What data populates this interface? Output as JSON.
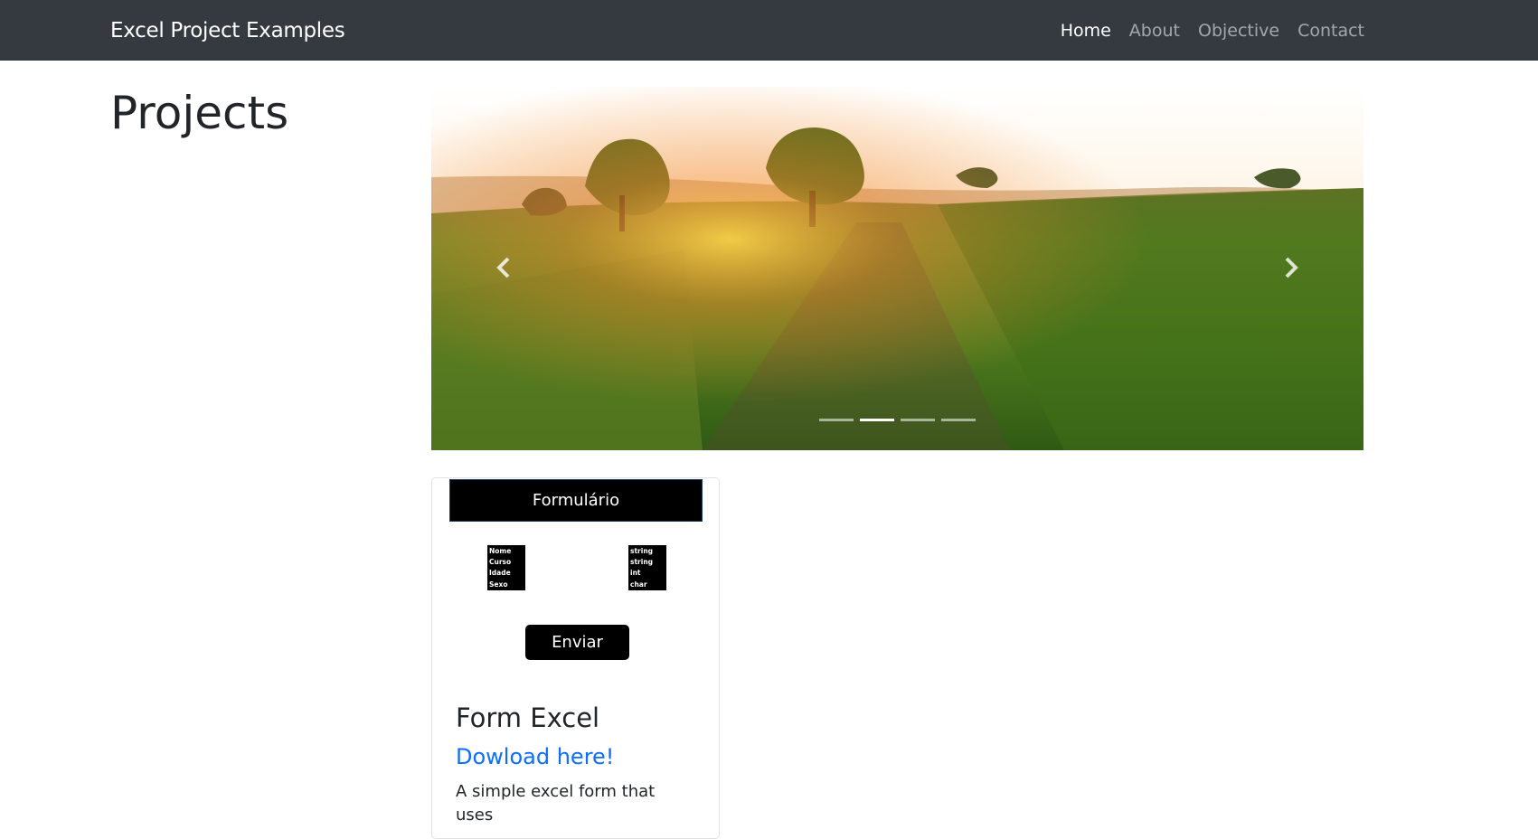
{
  "navbar": {
    "brand": "Excel Project Examples",
    "links": [
      {
        "label": "Home",
        "active": true
      },
      {
        "label": "About",
        "active": false
      },
      {
        "label": "Objective",
        "active": false
      },
      {
        "label": "Contact",
        "active": false
      }
    ]
  },
  "page": {
    "title": "Projects"
  },
  "carousel": {
    "slide_count": 4,
    "active_index": 1,
    "prev_icon": "chevron-left-icon",
    "next_icon": "chevron-right-icon"
  },
  "card": {
    "image": {
      "header": "Formulário",
      "labels": [
        "Nome",
        "Curso",
        "Idade",
        "Sexo"
      ],
      "types": [
        "string",
        "string",
        "int",
        "char"
      ],
      "button": "Enviar"
    },
    "title": "Form Excel",
    "link": "Dowload here!",
    "text": "A simple excel form that uses"
  },
  "colors": {
    "navbar_bg": "#343a40",
    "link": "#0d6efd",
    "text": "#212529"
  }
}
